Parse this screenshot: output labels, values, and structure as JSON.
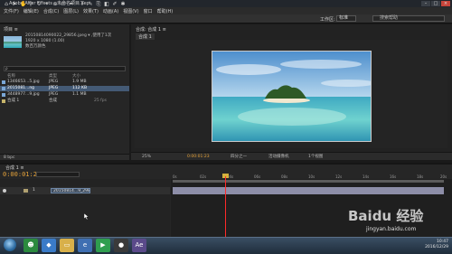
{
  "app": {
    "title": "Adobe After Effects - 未命名项目.aep",
    "window_controls": [
      "–",
      "□",
      "×"
    ]
  },
  "menu": [
    "文件(F)",
    "编辑(E)",
    "合成(C)",
    "图层(L)",
    "效果(T)",
    "动画(A)",
    "视图(V)",
    "窗口",
    "帮助(H)"
  ],
  "toolbar": {
    "workspace_label": "工作区:",
    "workspace_value": "标准",
    "help_search_placeholder": "搜索帮助"
  },
  "project_panel": {
    "tab": "项目 ≡",
    "item_name": "20150814090022_29856.jpeg ▾ ,使用了1次",
    "item_dims": "1920 x 1080 (1.00)",
    "item_color": "数百万颜色",
    "search_placeholder": "ρ",
    "columns": [
      "名称",
      "类型",
      "大小"
    ],
    "rows": [
      {
        "name": "1346653...5.jpg",
        "type": "JPEG",
        "size": "1.9 MB"
      },
      {
        "name": "2015081...ng",
        "type": "JPEG",
        "size": "112 KB"
      },
      {
        "name": "3448977...9.jpg",
        "type": "JPEG",
        "size": "1.1 MB"
      },
      {
        "name": "合成 1",
        "type": "合成",
        "size": "",
        "extra": "25 fps"
      }
    ],
    "bottom": "8 bpc"
  },
  "comp_panel": {
    "tab": "合成: 合成 1 ≡",
    "sub_tab": "合成 1",
    "zoom": "25%",
    "timecode": "0:00:01:23",
    "resolution": "四分之一",
    "camera": "活动摄像机",
    "views": "1个视图"
  },
  "timeline": {
    "tab": "合成 1 ≡",
    "timecode": "0:00:01:23",
    "layer_name": "20150814...9_29856.jpeg",
    "ruler_ticks": [
      "0s",
      "02s",
      "04s",
      "06s",
      "08s",
      "10s",
      "12s",
      "14s",
      "16s",
      "18s",
      "20s"
    ]
  },
  "taskbar": {
    "time": "10:47",
    "date": "2016/12/29"
  },
  "watermark": {
    "brand": "Baidu 经验",
    "url": "jingyan.baidu.com"
  }
}
